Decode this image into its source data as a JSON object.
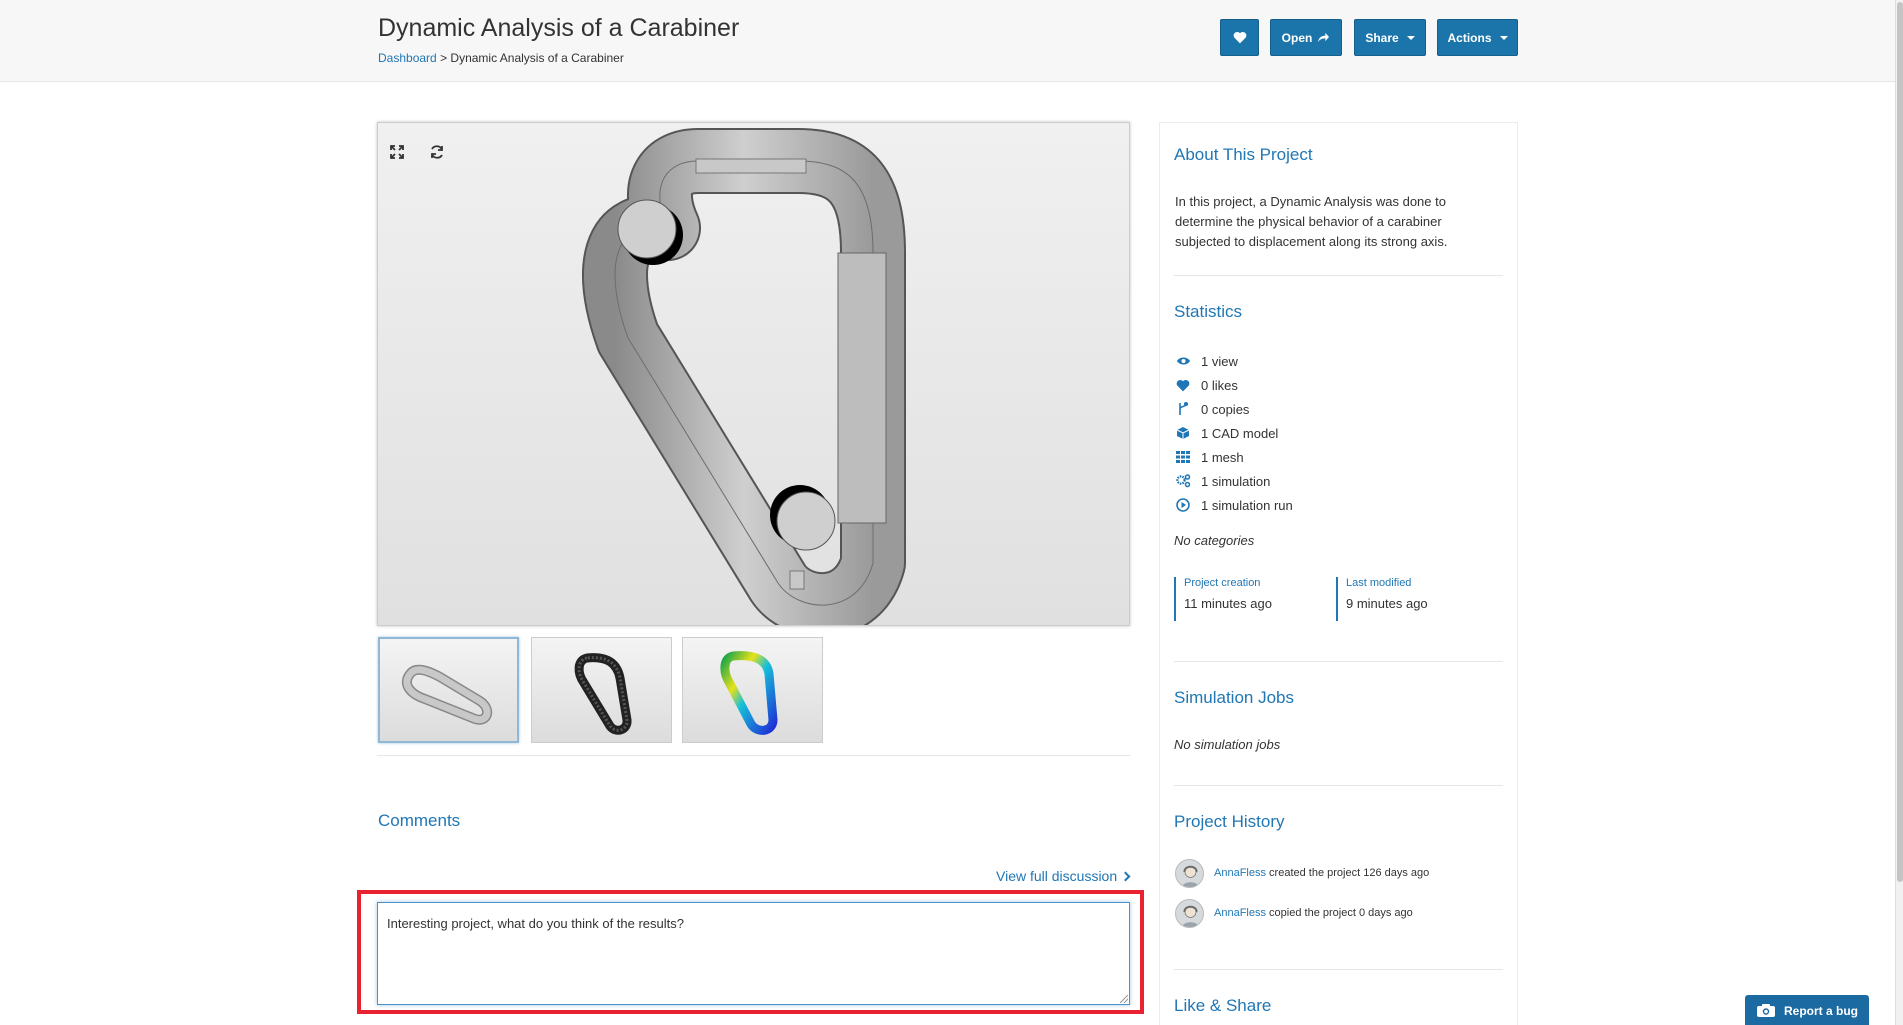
{
  "header": {
    "title": "Dynamic Analysis of a Carabiner",
    "breadcrumb": {
      "root": "Dashboard",
      "separator": ">",
      "current": "Dynamic Analysis of a Carabiner"
    },
    "buttons": {
      "open": "Open",
      "share": "Share",
      "actions": "Actions"
    }
  },
  "viewer": {
    "tools": [
      "expand-icon",
      "refresh-icon"
    ],
    "thumbnails": [
      "CAD model",
      "Mesh",
      "Simulation result"
    ]
  },
  "comments": {
    "title": "Comments",
    "view_full": "View full discussion",
    "input_value": "Interesting project, what do you think of the results?"
  },
  "sidebar": {
    "about": {
      "title": "About This Project",
      "text": "In this project, a Dynamic Analysis was done to determine the physical behavior of a carabiner subjected to displacement along its strong axis."
    },
    "statistics": {
      "title": "Statistics",
      "items": [
        {
          "icon": "eye-icon",
          "label": "1 view"
        },
        {
          "icon": "heart-icon",
          "label": "0 likes"
        },
        {
          "icon": "fork-icon",
          "label": "0 copies"
        },
        {
          "icon": "cube-icon",
          "label": "1 CAD model"
        },
        {
          "icon": "grid-icon",
          "label": "1 mesh"
        },
        {
          "icon": "gears-icon",
          "label": "1 simulation"
        },
        {
          "icon": "play-icon",
          "label": "1 simulation run"
        }
      ],
      "categories": "No categories",
      "created_label": "Project creation",
      "created_value": "11 minutes ago",
      "modified_label": "Last modified",
      "modified_value": "9 minutes ago"
    },
    "jobs": {
      "title": "Simulation Jobs",
      "empty": "No simulation jobs"
    },
    "history": {
      "title": "Project History",
      "entries": [
        {
          "user": "AnnaFless",
          "action": "created the project 126 days ago"
        },
        {
          "user": "AnnaFless",
          "action": "copied the project 0 days ago"
        }
      ]
    },
    "like_share": {
      "title": "Like & Share"
    }
  },
  "report_bug": "Report a bug",
  "colors": {
    "accent": "#2077b5",
    "button": "#1b75ab",
    "highlight": "#e8232f"
  }
}
